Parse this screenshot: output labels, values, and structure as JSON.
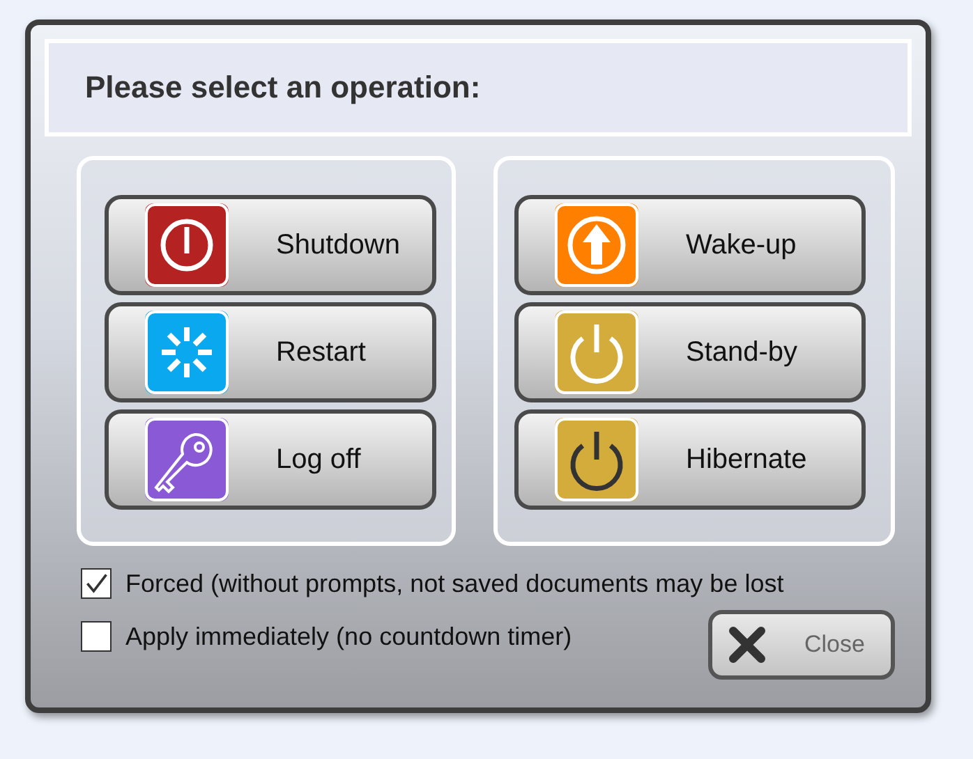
{
  "header": {
    "title": "Please select an operation:"
  },
  "groups": [
    {
      "buttons": [
        {
          "label": "Shutdown",
          "kind": "power-ring",
          "color": "#b52222"
        },
        {
          "label": "Restart",
          "kind": "spinner",
          "color": "#0aa8ee"
        },
        {
          "label": "Log off",
          "kind": "key",
          "color": "#8a5ad6"
        }
      ]
    },
    {
      "buttons": [
        {
          "label": "Wake-up",
          "kind": "up-arrow",
          "color": "#ff8000"
        },
        {
          "label": "Stand-by",
          "kind": "power-light",
          "color": "#d4ac3c"
        },
        {
          "label": "Hibernate",
          "kind": "power-dark",
          "color": "#d4ac3c"
        }
      ]
    }
  ],
  "options": [
    {
      "label": "Forced (without prompts, not saved documents may be lost",
      "checked": true
    },
    {
      "label": "Apply immediately (no countdown timer)",
      "checked": false
    }
  ],
  "close_button": {
    "label": "Close"
  }
}
